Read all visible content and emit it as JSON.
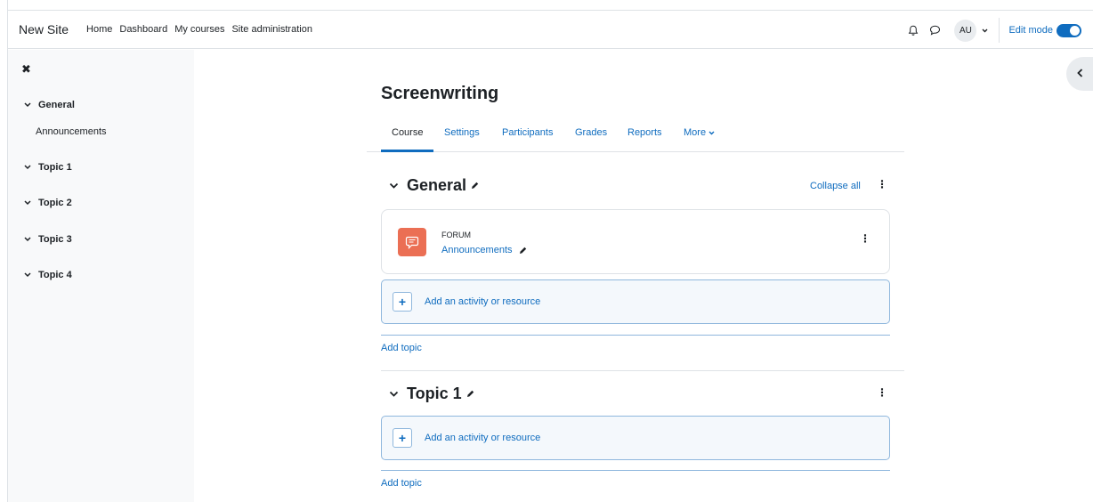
{
  "navbar": {
    "brand": "New Site",
    "links": [
      "Home",
      "Dashboard",
      "My courses",
      "Site administration"
    ],
    "avatar_initials": "AU",
    "edit_mode_label": "Edit mode",
    "edit_mode_on": true
  },
  "course_index": {
    "items": [
      {
        "label": "General",
        "children": [
          "Announcements"
        ]
      },
      {
        "label": "Topic 1"
      },
      {
        "label": "Topic 2"
      },
      {
        "label": "Topic 3"
      },
      {
        "label": "Topic 4"
      }
    ]
  },
  "page": {
    "title": "Screenwriting",
    "tabs": [
      "Course",
      "Settings",
      "Participants",
      "Grades",
      "Reports",
      "More"
    ],
    "active_tab": "Course",
    "collapse_all": "Collapse all"
  },
  "sections": [
    {
      "title": "General",
      "activity": {
        "type": "FORUM",
        "name": "Announcements"
      },
      "add_activity": "Add an activity or resource",
      "add_topic": "Add topic"
    },
    {
      "title": "Topic 1",
      "add_activity": "Add an activity or resource",
      "add_topic": "Add topic"
    }
  ],
  "colors": {
    "accent": "#0f6cbf",
    "forum_icon": "#eb6f54"
  }
}
